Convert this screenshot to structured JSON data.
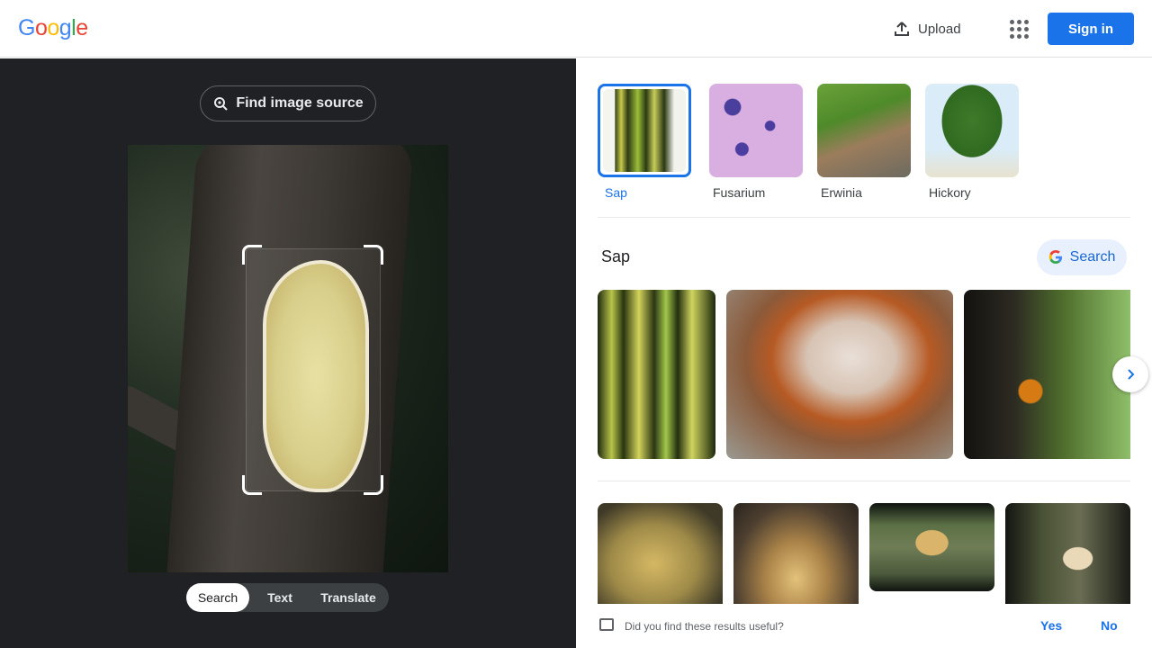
{
  "header": {
    "logo_letters": [
      "G",
      "o",
      "o",
      "g",
      "l",
      "e"
    ],
    "logo_colors": [
      "#4285f4",
      "#ea4335",
      "#fbbc05",
      "#4285f4",
      "#34a853",
      "#ea4335"
    ],
    "upload_label": "Upload",
    "apps_icon": "apps-grid-icon",
    "signin_label": "Sign in"
  },
  "left_panel": {
    "find_source_label": "Find image source",
    "modes": [
      "Search",
      "Text",
      "Translate"
    ],
    "active_mode": "Search"
  },
  "results": {
    "suggestions": [
      {
        "label": "Sap",
        "selected": true
      },
      {
        "label": "Fusarium",
        "selected": false
      },
      {
        "label": "Erwinia",
        "selected": false
      },
      {
        "label": "Hickory",
        "selected": false
      }
    ],
    "section_title": "Sap",
    "search_button_label": "Search",
    "next_icon": "chevron-right-icon"
  },
  "feedback": {
    "question": "Did you find these results useful?",
    "yes_label": "Yes",
    "no_label": "No"
  },
  "colors": {
    "accent": "#1a73e8",
    "dark_panel": "#202124"
  }
}
